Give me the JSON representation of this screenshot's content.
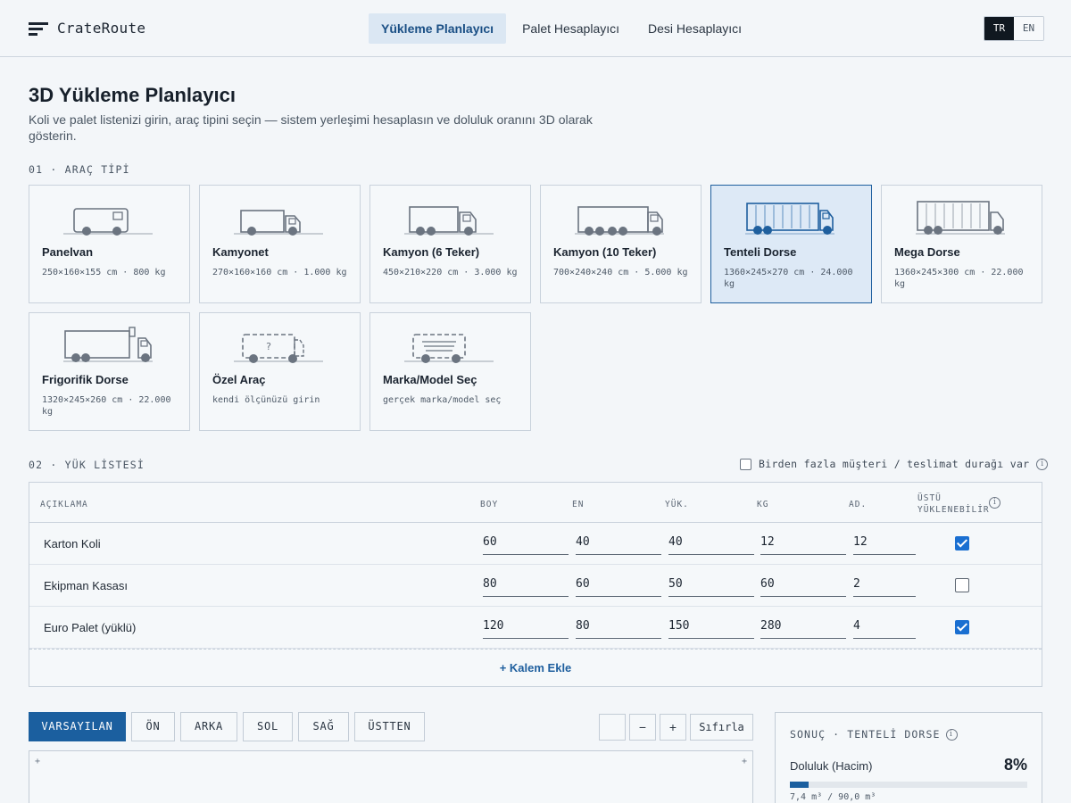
{
  "header": {
    "logo": "CrateRoute",
    "tabs": [
      {
        "label": "Yükleme Planlayıcı",
        "active": true
      },
      {
        "label": "Palet Hesaplayıcı",
        "active": false
      },
      {
        "label": "Desi Hesaplayıcı",
        "active": false
      }
    ],
    "lang": [
      {
        "label": "TR",
        "active": true
      },
      {
        "label": "EN",
        "active": false
      }
    ]
  },
  "page": {
    "title": "3D Yükleme Planlayıcı",
    "subtitle": "Koli ve palet listenizi girin, araç tipini seçin — sistem yerleşimi hesaplasın ve doluluk oranını 3D olarak gösterin."
  },
  "vehicle_section": {
    "label": "01 · ARAÇ TİPİ",
    "vehicles": [
      {
        "name": "Panelvan",
        "spec": "250×160×155 cm · 800 kg",
        "icon": "van-icon",
        "selected": false
      },
      {
        "name": "Kamyonet",
        "spec": "270×160×160 cm · 1.000 kg",
        "icon": "pickup-truck-icon",
        "selected": false
      },
      {
        "name": "Kamyon (6 Teker)",
        "spec": "450×210×220 cm · 3.000 kg",
        "icon": "truck-6-wheel-icon",
        "selected": false
      },
      {
        "name": "Kamyon (10 Teker)",
        "spec": "700×240×240 cm · 5.000 kg",
        "icon": "truck-10-wheel-icon",
        "selected": false
      },
      {
        "name": "Tenteli Dorse",
        "spec": "1360×245×270 cm · 24.000 kg",
        "icon": "curtain-trailer-icon",
        "selected": true
      },
      {
        "name": "Mega Dorse",
        "spec": "1360×245×300 cm · 22.000 kg",
        "icon": "mega-trailer-icon",
        "selected": false
      },
      {
        "name": "Frigorifik Dorse",
        "spec": "1320×245×260 cm · 22.000 kg",
        "icon": "reefer-trailer-icon",
        "selected": false
      },
      {
        "name": "Özel Araç",
        "spec": "kendi ölçünüzü girin",
        "icon": "custom-vehicle-icon",
        "selected": false
      },
      {
        "name": "Marka/Model Seç",
        "spec": "gerçek marka/model seç",
        "icon": "brand-model-icon",
        "selected": false
      }
    ]
  },
  "load_section": {
    "label": "02 · YÜK LİSTESİ",
    "multi_stop_label": "Birden fazla müşteri / teslimat durağı var",
    "multi_stop_checked": false,
    "columns": [
      "AÇIKLAMA",
      "BOY",
      "EN",
      "YÜK.",
      "KG",
      "AD.",
      "ÜSTÜ YÜKLENEBİLİR"
    ],
    "rows": [
      {
        "desc": "Karton Koli",
        "boy": "60",
        "en": "40",
        "yuk": "40",
        "kg": "12",
        "ad": "12",
        "stackable": true
      },
      {
        "desc": "Ekipman Kasası",
        "boy": "80",
        "en": "60",
        "yuk": "50",
        "kg": "60",
        "ad": "2",
        "stackable": false
      },
      {
        "desc": "Euro Palet (yüklü)",
        "boy": "120",
        "en": "80",
        "yuk": "150",
        "kg": "280",
        "ad": "4",
        "stackable": true
      }
    ],
    "add_label": "+ Kalem Ekle"
  },
  "view_controls": {
    "views": [
      {
        "label": "VARSAYILAN",
        "active": true
      },
      {
        "label": "ÖN",
        "active": false
      },
      {
        "label": "ARKA",
        "active": false
      },
      {
        "label": "SOL",
        "active": false
      },
      {
        "label": "SAĞ",
        "active": false
      },
      {
        "label": "ÜSTTEN",
        "active": false
      }
    ],
    "zoom_out": "−",
    "zoom_in": "+",
    "reset": "Sıfırla",
    "corner_marks": [
      "+",
      "+"
    ]
  },
  "result": {
    "title": "SONUÇ · TENTELİ DORSE",
    "fill_label": "Doluluk (Hacim)",
    "fill_pct_text": "8%",
    "fill_fraction": 0.08,
    "volume": "7,4 m³ / 90,0 m³"
  },
  "colors": {
    "accent": "#1b5f9f",
    "selected_bg": "#dde9f6",
    "checkbox_on": "#1a6fd1"
  }
}
